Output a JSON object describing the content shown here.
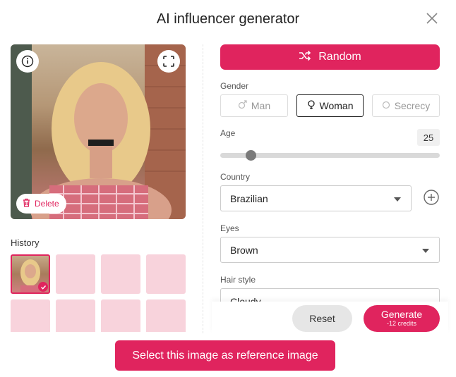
{
  "dialog": {
    "title": "AI influencer generator"
  },
  "preview": {
    "delete_label": "Delete"
  },
  "history": {
    "label": "History",
    "thumb_count": 8,
    "selected_index": 0
  },
  "controls": {
    "random_label": "Random",
    "gender": {
      "label": "Gender",
      "options": [
        "Man",
        "Woman",
        "Secrecy"
      ],
      "selected": "Woman"
    },
    "age": {
      "label": "Age",
      "value": "25",
      "slider_fraction": 0.11
    },
    "country": {
      "label": "Country",
      "value": "Brazilian"
    },
    "eyes": {
      "label": "Eyes",
      "value": "Brown"
    },
    "hair_style": {
      "label": "Hair style",
      "value": "Cloudy"
    }
  },
  "actions": {
    "reset_label": "Reset",
    "generate_label": "Generate",
    "generate_cost": "-12 credits",
    "select_reference_label": "Select this image as reference image"
  },
  "colors": {
    "accent": "#e0245e",
    "thumb_placeholder": "#f8d3dc"
  },
  "icons": [
    "close-icon",
    "info-icon",
    "fullscreen-icon",
    "trash-icon",
    "shuffle-icon",
    "male-icon",
    "female-icon",
    "circle-icon",
    "plus-circle-icon",
    "check-icon"
  ]
}
